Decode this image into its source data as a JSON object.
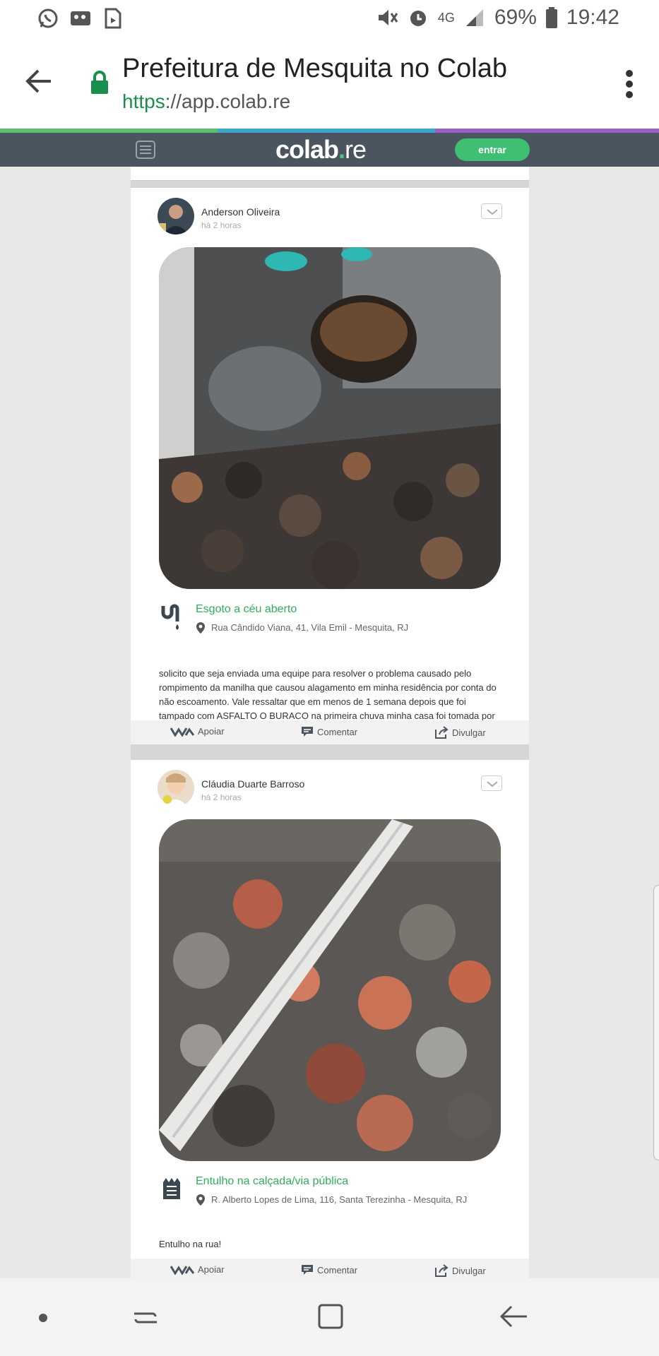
{
  "status_bar": {
    "battery": "69%",
    "time": "19:42",
    "network": "4G"
  },
  "browser": {
    "title": "Prefeitura de Mesquita no Colab",
    "url_scheme": "https",
    "url_rest": "://app.colab.re"
  },
  "app_header": {
    "brand_main": "colab",
    "brand_dot": ".",
    "brand_tld": "re",
    "enter_label": "entrar"
  },
  "posts": [
    {
      "author": "Anderson Oliveira",
      "time": "há 2 horas",
      "category": "Esgoto a céu aberto",
      "address": "Rua Cândido Viana, 41, Vila Emil - Mesquita, RJ",
      "description": "solicito que seja enviada uma equipe para resolver o problema causado pelo rompimento da manilha que causou alagamento em minha residência por conta do não escoamento. Vale ressaltar que em menos de 1 semana depois que foi tampado com ASFALTO O BURACO na primeira chuva minha casa foi tomada por esgoto.",
      "actions": {
        "support": "Apoiar",
        "comment": "Comentar",
        "share": "Divulgar"
      }
    },
    {
      "author": "Cláudia Duarte Barroso",
      "time": "há 2 horas",
      "category": "Entulho na calçada/via pública",
      "address": "R. Alberto Lopes de Lima, 116, Santa Terezinha - Mesquita, RJ",
      "description": "Entulho na rua!",
      "actions": {
        "support": "Apoiar",
        "comment": "Comentar",
        "share": "Divulgar"
      }
    }
  ],
  "colors": {
    "brand_green": "#3fbf72",
    "header_bg": "#4a5560",
    "category_green": "#2fae5c"
  }
}
